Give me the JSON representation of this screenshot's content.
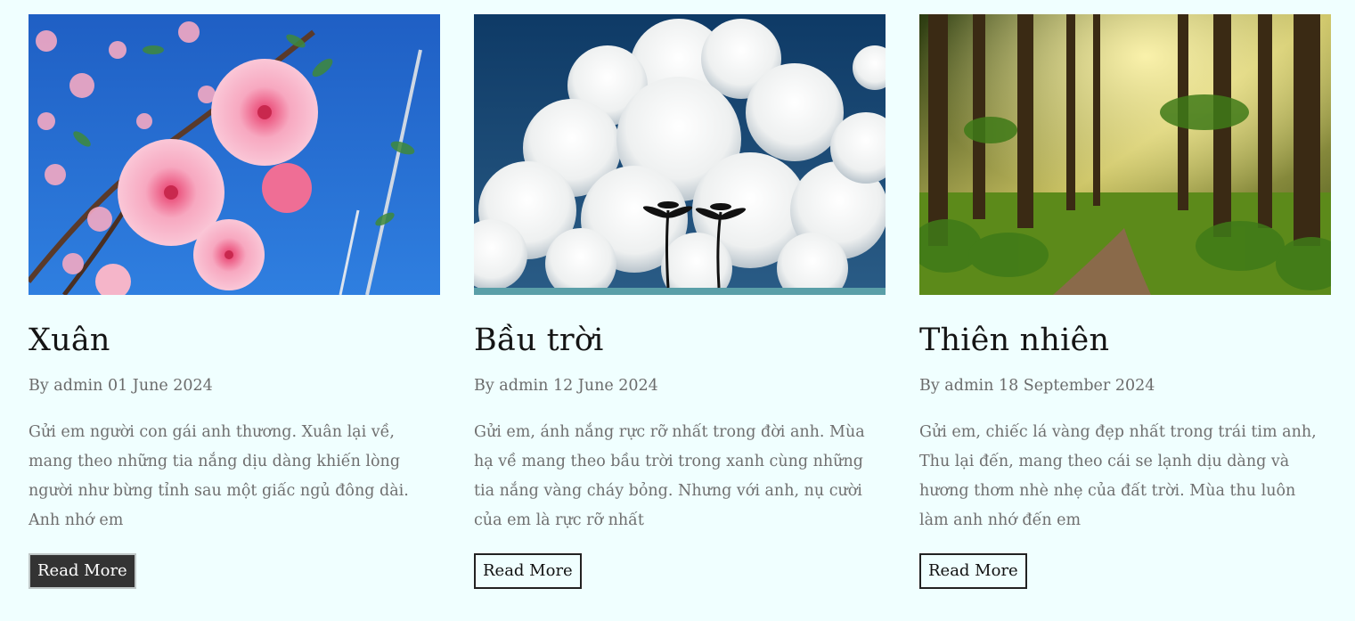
{
  "posts": [
    {
      "title": "Xuân",
      "meta": "By admin 01 June 2024",
      "excerpt": "Gửi em người con gái anh thương. Xuân lại về, mang theo những tia nắng dịu dàng khiến lòng người như bừng tỉnh sau một giấc ngủ đông dài. Anh nhớ em",
      "button": "Read More",
      "image": "peach-blossom-photo"
    },
    {
      "title": "Bầu trời",
      "meta": "By admin 12 June 2024",
      "excerpt": "Gửi em, ánh nắng rực rỡ nhất trong đời anh. Mùa hạ về mang theo bầu trời trong xanh cùng những tia nắng vàng cháy bỏng. Nhưng với anh, nụ cười của em là rực rỡ nhất",
      "button": "Read More",
      "image": "clouds-palm-trees-photo"
    },
    {
      "title": "Thiên nhiên",
      "meta": "By admin 18 September 2024",
      "excerpt": "Gửi em, chiếc lá vàng đẹp nhất trong trái tim anh, Thu lại đến, mang theo cái se lạnh dịu dàng và hương thơm nhè nhẹ của đất trời. Mùa thu luôn làm anh nhớ đến em",
      "button": "Read More",
      "image": "forest-sunlight-photo"
    }
  ],
  "colors": {
    "page_background": "#f0ffff",
    "button_active_bg": "#333333"
  }
}
